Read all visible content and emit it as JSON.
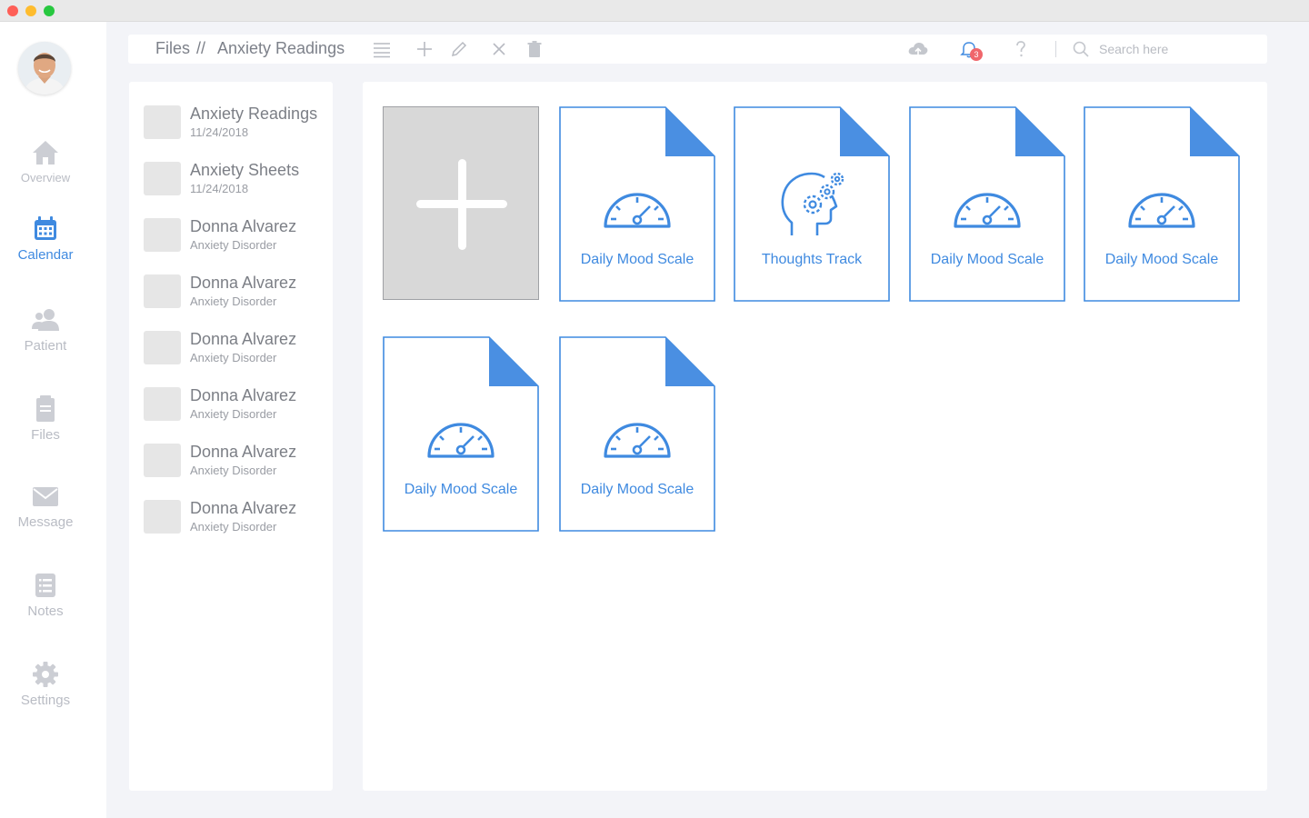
{
  "window": {
    "controls": [
      "close",
      "minimize",
      "zoom"
    ]
  },
  "sidebar": {
    "avatar": "user-avatar",
    "items": [
      {
        "label": "Overview",
        "icon": "home-icon",
        "active": false
      },
      {
        "label": "Calendar",
        "icon": "calendar-icon",
        "active": true
      },
      {
        "label": "Patient",
        "icon": "patient-icon",
        "active": false
      },
      {
        "label": "Files",
        "icon": "files-icon",
        "active": false
      },
      {
        "label": "Message",
        "icon": "mail-icon",
        "active": false
      },
      {
        "label": "Notes",
        "icon": "notes-icon",
        "active": false
      },
      {
        "label": "Settings",
        "icon": "gear-icon",
        "active": false
      }
    ]
  },
  "toolbar": {
    "breadcrumb": {
      "root": "Files",
      "separator": "//",
      "current": "Anxiety Readings"
    },
    "actions": [
      "list-icon",
      "plus-icon",
      "pencil-icon",
      "close-icon",
      "trash-icon"
    ],
    "utilities": [
      "cloud-upload-icon",
      "bell-icon",
      "help-icon"
    ],
    "notifications_count": "3",
    "search": {
      "placeholder": "Search here",
      "value": ""
    }
  },
  "file_list": [
    {
      "title": "Anxiety Readings",
      "subtitle": "11/24/2018"
    },
    {
      "title": "Anxiety Sheets",
      "subtitle": "11/24/2018"
    },
    {
      "title": "Donna Alvarez",
      "subtitle": "Anxiety Disorder"
    },
    {
      "title": "Donna Alvarez",
      "subtitle": "Anxiety Disorder"
    },
    {
      "title": "Donna Alvarez",
      "subtitle": "Anxiety Disorder"
    },
    {
      "title": "Donna Alvarez",
      "subtitle": "Anxiety Disorder"
    },
    {
      "title": "Donna Alvarez",
      "subtitle": "Anxiety Disorder"
    },
    {
      "title": "Donna Alvarez",
      "subtitle": "Anxiety Disorder"
    }
  ],
  "documents": [
    {
      "label": "Daily Mood Scale",
      "icon": "gauge-icon"
    },
    {
      "label": "Thoughts Track",
      "icon": "head-gears-icon"
    },
    {
      "label": "Daily Mood Scale",
      "icon": "gauge-icon"
    },
    {
      "label": "Daily Mood Scale",
      "icon": "gauge-icon"
    },
    {
      "label": "Daily Mood Scale",
      "icon": "gauge-icon"
    },
    {
      "label": "Daily Mood Scale",
      "icon": "gauge-icon"
    }
  ],
  "colors": {
    "accent": "#3f8ae0",
    "muted_nav": "#b9bcc4",
    "badge": "#f0666b",
    "background": "#f3f4f8",
    "add_tile": "#d8d8d8"
  }
}
